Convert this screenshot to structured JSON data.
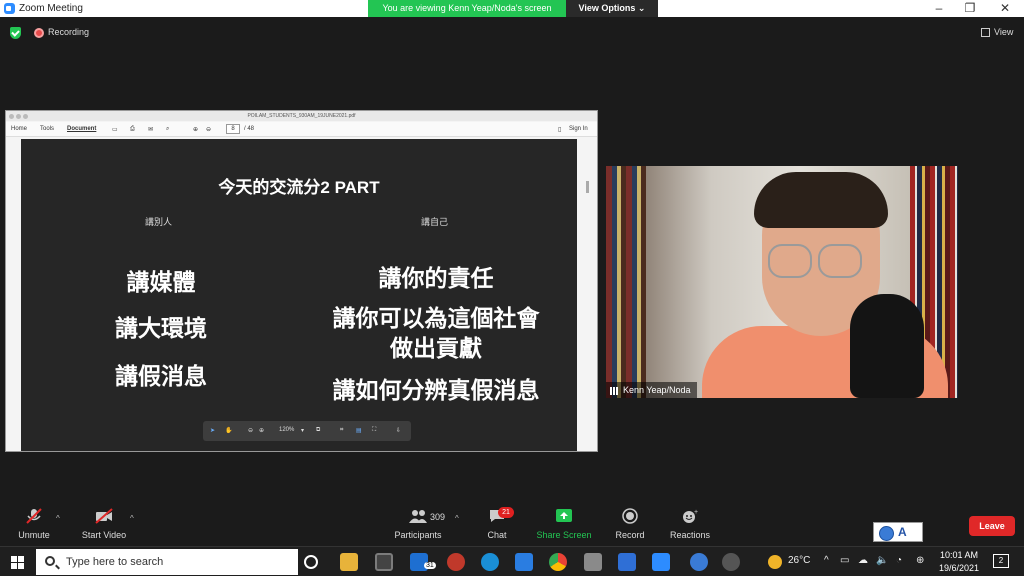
{
  "window": {
    "title": "Zoom Meeting",
    "share_banner": "You are viewing Kenn Yeap/Noda's screen",
    "view_options": "View Options ⌄"
  },
  "meeting": {
    "recording_label": "Recording",
    "view_label": "View"
  },
  "shared_pdf": {
    "filename": "POILAM_STUDENTS_930AM_19JUNE2021.pdf",
    "menu": [
      "Home",
      "Tools",
      "Document"
    ],
    "page_current": "8",
    "page_total": "/ 48",
    "sign_in": "Sign In",
    "zoom_level": "120%",
    "slide": {
      "title": "今天的交流分2 PART",
      "left_heading": "講別人",
      "right_heading": "講自己",
      "left_items": [
        "講媒體",
        "講大環境",
        "講假消息"
      ],
      "right_items": [
        "講你的責任",
        "講你可以為這個社會",
        "做出貢獻",
        "講如何分辨真假消息"
      ]
    }
  },
  "video": {
    "participant_name": "Kenn Yeap/Noda"
  },
  "toolbar": {
    "unmute": "Unmute",
    "start_video": "Start Video",
    "participants": "Participants",
    "participants_count": "309",
    "chat": "Chat",
    "chat_badge": "21",
    "share_screen": "Share Screen",
    "record": "Record",
    "reactions": "Reactions",
    "leave": "Leave",
    "language": "A"
  },
  "taskbar": {
    "search_placeholder": "Type here to search",
    "mail_badge": "31",
    "weather": "26°C",
    "time": "10:01 AM",
    "date": "19/6/2021",
    "notifications": "2"
  },
  "colors": {
    "share_green": "#23c553",
    "leave_red": "#e02828",
    "zoom_blue": "#2d8cff"
  }
}
